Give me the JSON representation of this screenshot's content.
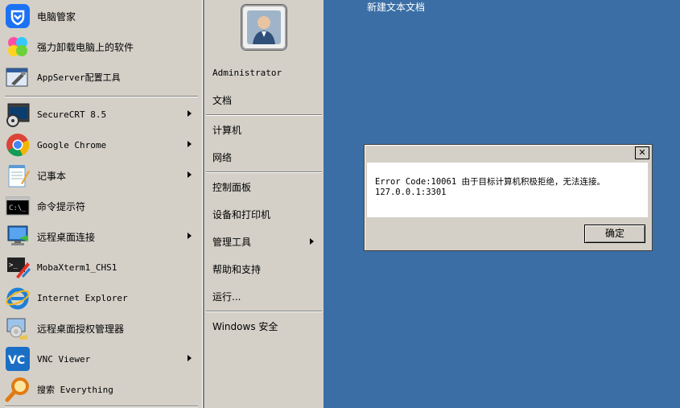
{
  "desktop": {
    "file_label": "新建文本文档"
  },
  "start_menu": {
    "left_items": [
      {
        "label": "电脑管家",
        "icon": "tencent-pc-manager-icon",
        "submenu": false
      },
      {
        "label": "强力卸载电脑上的软件",
        "icon": "uninstaller-icon",
        "submenu": false
      },
      {
        "label": "AppServer配置工具",
        "icon": "appserver-config-icon",
        "submenu": false
      },
      {
        "label": "SecureCRT 8.5",
        "icon": "securecrt-icon",
        "submenu": true
      },
      {
        "label": "Google Chrome",
        "icon": "chrome-icon",
        "submenu": true
      },
      {
        "label": "记事本",
        "icon": "notepad-icon",
        "submenu": true
      },
      {
        "label": "命令提示符",
        "icon": "cmd-icon",
        "submenu": false
      },
      {
        "label": "远程桌面连接",
        "icon": "remote-desktop-icon",
        "submenu": true
      },
      {
        "label": "MobaXterm1_CHS1",
        "icon": "mobaxterm-icon",
        "submenu": false
      },
      {
        "label": "Internet Explorer",
        "icon": "internet-explorer-icon",
        "submenu": false
      },
      {
        "label": "远程桌面授权管理器",
        "icon": "rd-licensing-icon",
        "submenu": false
      },
      {
        "label": "VNC Viewer",
        "icon": "vnc-viewer-icon",
        "submenu": true
      },
      {
        "label": "搜索 Everything",
        "icon": "everything-search-icon",
        "submenu": false
      }
    ],
    "right_items": [
      {
        "label": "Administrator",
        "submenu": false
      },
      {
        "label": "文档",
        "submenu": false
      },
      {
        "label": "计算机",
        "submenu": false
      },
      {
        "label": "网络",
        "submenu": false
      },
      {
        "label": "控制面板",
        "submenu": false
      },
      {
        "label": "设备和打印机",
        "submenu": false
      },
      {
        "label": "管理工具",
        "submenu": true
      },
      {
        "label": "帮助和支持",
        "submenu": false
      },
      {
        "label": "运行...",
        "submenu": false
      },
      {
        "label": "Windows 安全",
        "submenu": false
      }
    ]
  },
  "dialog": {
    "message_line1": "Error Code:10061 由于目标计算机积极拒绝，无法连接。",
    "message_line2": "127.0.0.1:3301",
    "ok_label": "确定",
    "close_glyph": "✕"
  },
  "colors": {
    "desktop": "#3a6ea5",
    "menu": "#d4d0c8"
  }
}
